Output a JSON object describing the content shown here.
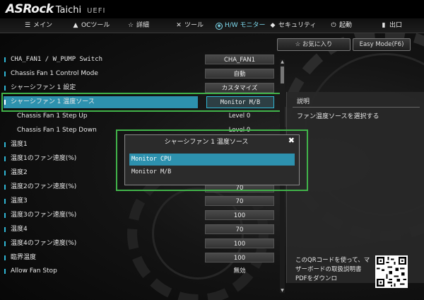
{
  "header": {
    "brand": "ASRock",
    "model": "Taichi",
    "uefi": "UEFI"
  },
  "nav": {
    "tabs": [
      {
        "icon": "grid-icon",
        "label": "メイン"
      },
      {
        "icon": "flame-icon",
        "label": "OCツール"
      },
      {
        "icon": "star-icon",
        "label": "詳細"
      },
      {
        "icon": "wrench-icon",
        "label": "ツール"
      },
      {
        "icon": "monitor-icon",
        "label": "H/W モニター",
        "active": true
      },
      {
        "icon": "shield-icon",
        "label": "セキュリティ"
      },
      {
        "icon": "power-icon",
        "label": "起動"
      },
      {
        "icon": "exit-icon",
        "label": "出口"
      }
    ]
  },
  "top_buttons": {
    "favorites": "お気に入り",
    "easy_mode": "Easy Mode(F6)"
  },
  "settings": [
    {
      "label": "CHA_FAN1 / W_PUMP Switch",
      "value": "CHA_FAN1"
    },
    {
      "label": "Chassis Fan 1 Control Mode",
      "value": "自動"
    },
    {
      "label": "シャーシファン 1 設定",
      "value": "カスタマイズ"
    },
    {
      "label": "シャーシファン 1 温度ソース",
      "value": "Monitor M/B",
      "selected": true
    },
    {
      "label": "Chassis Fan 1 Step Up",
      "value": "Level 0"
    },
    {
      "label": "Chassis Fan 1 Step Down",
      "value": "Level 0"
    },
    {
      "label": "温度1",
      "value": ""
    },
    {
      "label": "温度1のファン速度(%)",
      "value": ""
    },
    {
      "label": "温度2",
      "value": ""
    },
    {
      "label": "温度2のファン速度(%)",
      "value": "70"
    },
    {
      "label": "温度3",
      "value": "70"
    },
    {
      "label": "温度3のファン速度(%)",
      "value": "100"
    },
    {
      "label": "温度4",
      "value": "70"
    },
    {
      "label": "温度4のファン速度(%)",
      "value": "100"
    },
    {
      "label": "臨界温度",
      "value": "100"
    },
    {
      "label": "Allow Fan Stop",
      "value": "無効"
    }
  ],
  "description": {
    "title": "説明",
    "text": "ファン温度ソースを選択する"
  },
  "qr": {
    "text": "このQRコードを使って、マザーボードの取扱説明書PDFをダウンロ"
  },
  "popup": {
    "title": "シャーシファン 1 温度ソース",
    "close": "✖",
    "options": [
      "Monitor CPU",
      "Monitor M/B"
    ]
  },
  "colors": {
    "highlight": "#2d91ae",
    "callout": "#41b34a",
    "accent": "#7fdcf0"
  }
}
